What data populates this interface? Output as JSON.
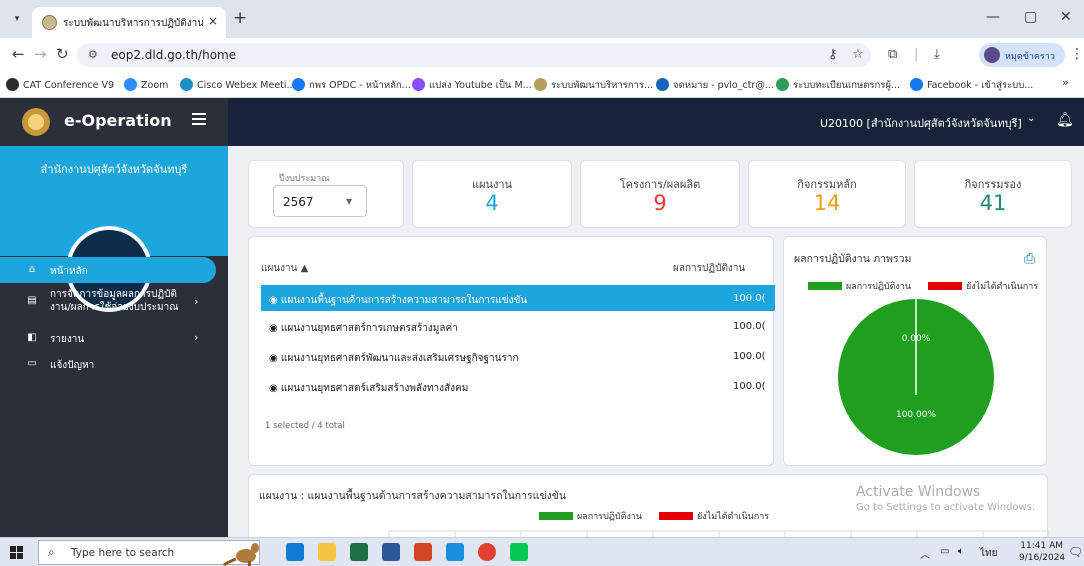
{
  "browser": {
    "tab_title": "ระบบพัฒนาบริหารการปฏิบัติงาน (e-",
    "tab_close": "×",
    "new_tab": "+",
    "url": "eop2.dld.go.th/home",
    "profile_name": "หมุดข้าคราว",
    "win_min": "—",
    "win_max": "▢",
    "win_close": "✕",
    "bookmarks": [
      {
        "label": "CAT Conference V9",
        "color": "#2b2b2b"
      },
      {
        "label": "Zoom",
        "color": "#2d8cff"
      },
      {
        "label": "Cisco Webex Meeti...",
        "color": "#1e90c8"
      },
      {
        "label": "กพร OPDC - หน้าหลัก...",
        "color": "#1877f2"
      },
      {
        "label": "แปลง Youtube เป็น M...",
        "color": "#8a4dff"
      },
      {
        "label": "ระบบพัฒนาบริหารการ...",
        "color": "#b59d5a"
      },
      {
        "label": "จดหมาย - pvlo_ctr@...",
        "color": "#1565c0"
      },
      {
        "label": "ระบบทะเบียนเกษตรกรผู้...",
        "color": "#2e9d5b"
      },
      {
        "label": "Facebook - เข้าสู่ระบบ...",
        "color": "#1877f2"
      }
    ],
    "more_bookmarks": "»"
  },
  "app": {
    "brand": "e-Operation",
    "org_name": "สำนักงานปศุสัตว์จังหวัดจันทบุรี",
    "user_label": "U20100 [สำนักงานปศุสัตว์จังหวัดจันทบุรี]",
    "menu": [
      {
        "label": "หน้าหลัก",
        "icon": "home-icon",
        "glyph": "⌂",
        "arrow": ""
      },
      {
        "label": "การจัดการข้อมูลผลการปฏิบัติ\nงาน/ผลการใช้จ่ายงบประมาณ",
        "icon": "form-icon",
        "glyph": "▤",
        "arrow": "›"
      },
      {
        "label": "รายงาน",
        "icon": "report-icon",
        "glyph": "◧",
        "arrow": "›"
      },
      {
        "label": "แจ้งปัญหา",
        "icon": "chat-icon",
        "glyph": "▭",
        "arrow": ""
      }
    ]
  },
  "dashboard": {
    "year_label": "ปีงบประมาณ",
    "year_value": "2567",
    "stats": [
      {
        "label": "แผนงาน",
        "value": "4",
        "color": "#1da5dd"
      },
      {
        "label": "โครงการ/ผลผลิต",
        "value": "9",
        "color": "#e53935"
      },
      {
        "label": "กิจกรรมหลัก",
        "value": "14",
        "color": "#f39c12"
      },
      {
        "label": "กิจกรรมรอง",
        "value": "41",
        "color": "#1e8c6e"
      }
    ],
    "list": {
      "col_plan": "แผนงาน ▲",
      "col_result": "ผลการปฏิบัติงาน",
      "rows": [
        {
          "name": "◉ แผนงานพื้นฐานด้านการสร้างความสามารถในการแข่งขัน",
          "value": "100.0(",
          "selected": true
        },
        {
          "name": "◉ แผนงานยุทธศาสตร์การเกษตรสร้างมูลค่า",
          "value": "100.0(",
          "selected": false
        },
        {
          "name": "◉ แผนงานยุทธศาสตร์พัฒนาและส่งเสริมเศรษฐกิจฐานราก",
          "value": "100.0(",
          "selected": false
        },
        {
          "name": "◉ แผนงานยุทธศาสตร์เสริมสร้างพลังทางสังคม",
          "value": "100.0(",
          "selected": false
        }
      ],
      "footer": "1 selected / 4 total"
    },
    "bottom_title": "แผนงาน : แผนงานพื้นฐานด้านการสร้างความสามารถในการแข่งขัน",
    "watermark_title": "Activate Windows",
    "watermark_sub": "Go to Settings to activate Windows."
  },
  "chart_data": [
    {
      "type": "pie",
      "title": "ผลการปฏิบัติงาน ภาพรวม",
      "legend": [
        "ผลการปฏิบัติงาน",
        "ยังไม่ได้ดำเนินการ"
      ],
      "legend_position": "top",
      "slices": [
        {
          "name": "ผลการปฏิบัติงาน",
          "value": 100.0,
          "label": "100.00%",
          "color": "#1f9e1f"
        },
        {
          "name": "ยังไม่ได้ดำเนินการ",
          "value": 0.0,
          "label": "0.00%",
          "color": "#e00000"
        }
      ]
    },
    {
      "type": "bar",
      "title": "แผนงาน : แผนงานพื้นฐานด้านการสร้างความสามารถในการแข่งขัน",
      "legend": [
        "ผลการปฏิบัติงาน",
        "ยังไม่ได้ดำเนินการ"
      ],
      "legend_position": "top",
      "colors": [
        "#1f9e1f",
        "#e00000"
      ],
      "grid": true
    }
  ],
  "taskbar": {
    "search_placeholder": "Type here to search",
    "tray_lang": "ไทย",
    "time": "11:41 AM",
    "date": "9/16/2024",
    "notif_count": "2",
    "apps": [
      {
        "name": "edge-app-icon",
        "color": "#0f7bd4"
      },
      {
        "name": "file-explorer-app-icon",
        "color": "#f4c542"
      },
      {
        "name": "excel-app-icon",
        "color": "#1d7044"
      },
      {
        "name": "word-app-icon",
        "color": "#2b5797"
      },
      {
        "name": "powerpoint-app-icon",
        "color": "#d24726"
      },
      {
        "name": "ie-app-icon",
        "color": "#1a8fe0"
      },
      {
        "name": "chrome-app-icon",
        "color": "#e34133"
      },
      {
        "name": "line-app-icon",
        "color": "#06c755"
      }
    ]
  }
}
